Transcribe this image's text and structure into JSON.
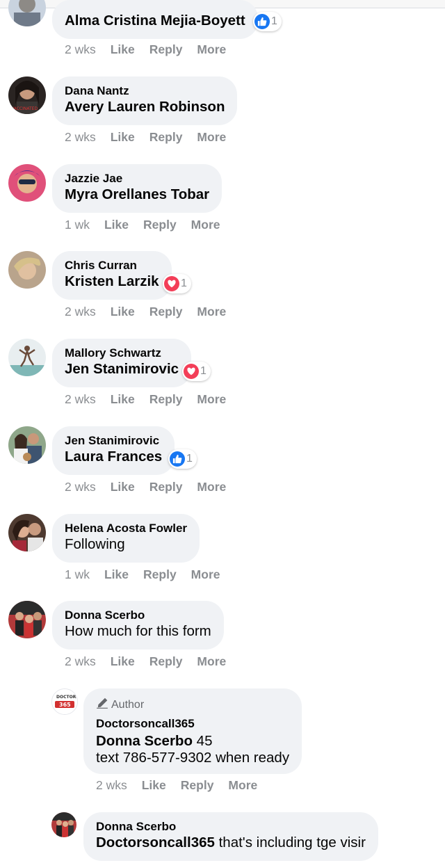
{
  "comments": [
    {
      "reply_to": "",
      "name": "Alma Cristina Mejia-Boyett",
      "time": "2 wks",
      "reaction": {
        "type": "like",
        "count": "1"
      }
    },
    {
      "author": "Dana Nantz",
      "tag": "Avery Lauren Robinson",
      "text": "",
      "time": "2 wks"
    },
    {
      "author": "Jazzie Jae",
      "tag": "Myra Orellanes Tobar",
      "text": "",
      "time": "1 wk"
    },
    {
      "author": "Chris Curran",
      "tag": "Kristen Larzik",
      "text": "",
      "time": "2 wks",
      "reaction": {
        "type": "love",
        "count": "1"
      }
    },
    {
      "author": "Mallory Schwartz",
      "tag": "Jen Stanimirovic",
      "text": "",
      "time": "2 wks",
      "reaction": {
        "type": "love",
        "count": "1"
      }
    },
    {
      "author": "Jen Stanimirovic",
      "tag": "Laura Frances",
      "text": "",
      "time": "2 wks",
      "reaction": {
        "type": "like",
        "count": "1"
      }
    },
    {
      "author": "Helena Acosta Fowler",
      "tag": "",
      "text": "Following",
      "time": "1 wk"
    },
    {
      "author": "Donna Scerbo",
      "tag": "",
      "text": "How much for this form",
      "time": "2 wks"
    }
  ],
  "replies": [
    {
      "badge": "Author",
      "author": "Doctorsoncall365",
      "tag": "Donna Scerbo",
      "text": " 45",
      "text2": "text 786-577-9302 when ready",
      "time": "2 wks"
    },
    {
      "author": "Donna Scerbo",
      "tag": "Doctorsoncall365",
      "text": " that's including tge visir"
    }
  ],
  "actions": {
    "like": "Like",
    "reply": "Reply",
    "more": "More"
  }
}
